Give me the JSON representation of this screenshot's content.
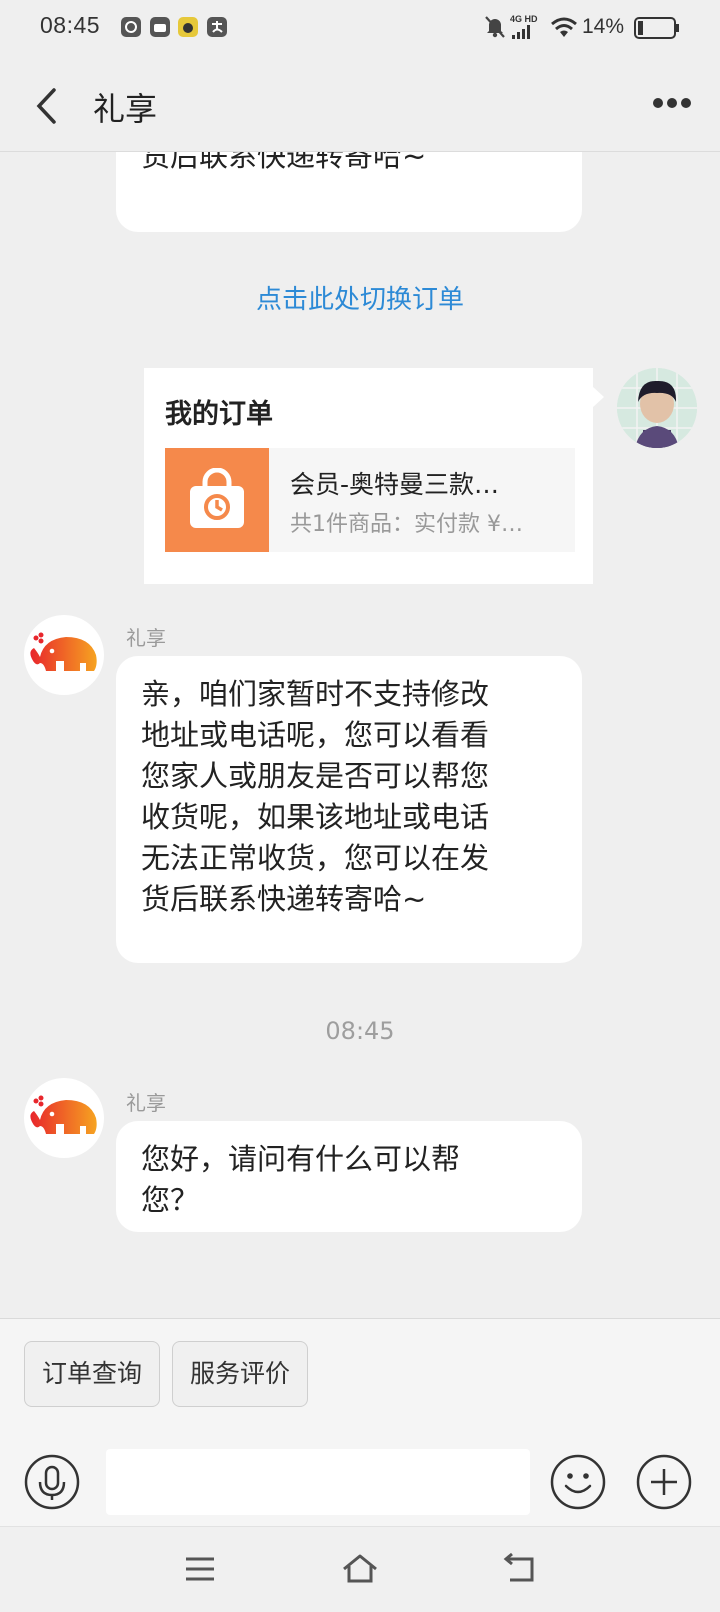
{
  "status_bar": {
    "time": "08:45",
    "network": "4G HD",
    "battery": "14%"
  },
  "header": {
    "title": "礼享"
  },
  "chat": {
    "top_partial_text": "货后联系快递转寄哈~",
    "switch_order_link": "点击此处切换订单",
    "order_card": {
      "title": "我的订单",
      "item_name": "会员-奥特曼三款…",
      "item_summary": "共1件商品：实付款 ¥…"
    },
    "messages": [
      {
        "sender": "礼享",
        "lines": [
          "亲，咱们家暂时不支持修改",
          "地址或电话呢，您可以看看",
          "您家人或朋友是否可以帮您",
          "收货呢，如果该地址或电话",
          "无法正常收货，您可以在发",
          "货后联系快递转寄哈~"
        ]
      },
      {
        "sender": "礼享",
        "lines": [
          "您好，请问有什么可以帮",
          "您？"
        ]
      }
    ],
    "time_divider": "08:45"
  },
  "quick_actions": [
    "订单查询",
    "服务评价"
  ],
  "input": {
    "placeholder": ""
  },
  "colors": {
    "link": "#2d8ad6",
    "brand_orange": "#f5894b",
    "brand_red": "#e8262c",
    "background": "#efefef"
  }
}
